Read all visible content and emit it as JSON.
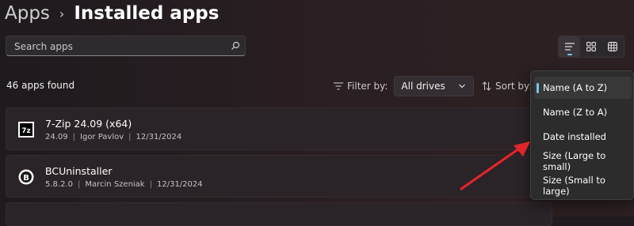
{
  "breadcrumb": {
    "parent": "Apps",
    "current": "Installed apps"
  },
  "search": {
    "placeholder": "Search apps"
  },
  "summary": {
    "count_text": "46 apps found"
  },
  "filter": {
    "label": "Filter by:",
    "value": "All drives"
  },
  "sort": {
    "label": "Sort by:",
    "options": [
      "Name (A to Z)",
      "Name (Z to A)",
      "Date installed",
      "Size (Large to small)",
      "Size (Small to large)"
    ],
    "selected": "Name (A to Z)"
  },
  "views": {
    "active": "list"
  },
  "apps": [
    {
      "name": "7-Zip 24.09 (x64)",
      "version": "24.09",
      "publisher": "Igor Pavlov",
      "date": "12/31/2024",
      "icon": "7zip-icon"
    },
    {
      "name": "BCUninstaller",
      "version": "5.8.2.0",
      "publisher": "Marcin Szeniak",
      "date": "12/31/2024",
      "icon": "bcuninstaller-icon"
    }
  ],
  "colors": {
    "accent": "#7cc2ea",
    "annotation_arrow": "#e0262b",
    "background": "#211b20"
  }
}
